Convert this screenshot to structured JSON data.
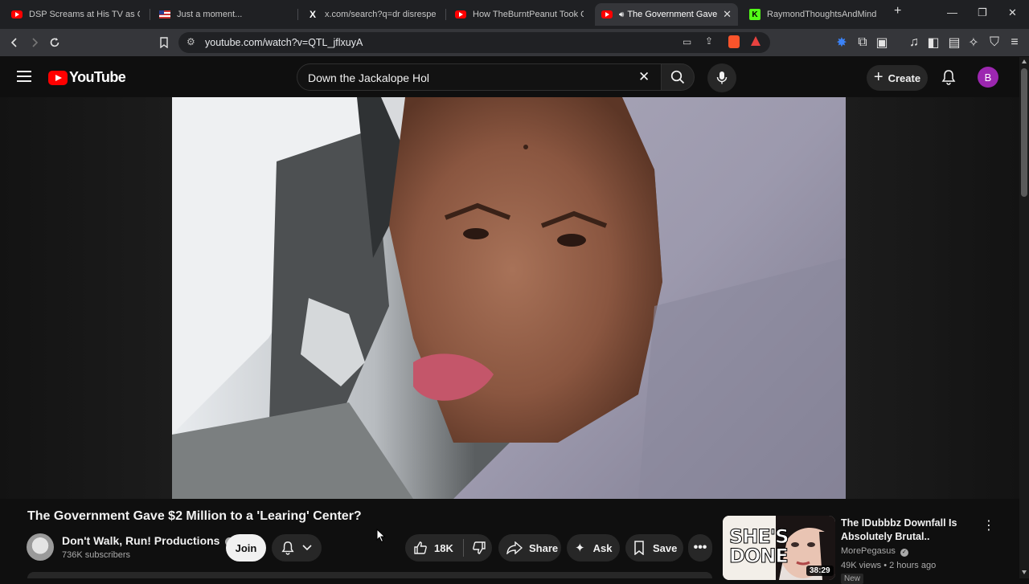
{
  "browser": {
    "tabs": [
      {
        "title": "DSP Screams at His TV as Call of",
        "icon": "youtube-favicon"
      },
      {
        "title": "Just a moment...",
        "icon": "flag-favicon"
      },
      {
        "title": "x.com/search?q=dr disrespect m",
        "icon": "x-favicon"
      },
      {
        "title": "How TheBurntPeanut Took Over",
        "icon": "youtube-favicon"
      },
      {
        "title": "The Government Gave $",
        "icon": "youtube-favicon",
        "active": true
      },
      {
        "title": "RaymondThoughtsAndMind Str",
        "icon": "kick-favicon"
      }
    ],
    "url": "youtube.com/watch?v=QTL_jflxuyA"
  },
  "youtube": {
    "logo_text": "YouTube",
    "search_value": "Down the Jackalope Hol",
    "create_label": "Create",
    "avatar_letter": "B"
  },
  "video": {
    "title": "The Government Gave $2 Million to a 'Learing' Center?",
    "channel": "Don't Walk, Run! Productions",
    "subscribers": "736K subscribers",
    "join_label": "Join",
    "likes": "18K",
    "share_label": "Share",
    "ask_label": "Ask",
    "save_label": "Save"
  },
  "recommended": {
    "title": "The IDubbbz Downfall Is Absolutely Brutal..",
    "channel": "MorePegasus",
    "meta": "49K views • 2 hours ago",
    "duration": "38:29",
    "thumb_text": "SHE'S DONE",
    "badge": "New"
  }
}
